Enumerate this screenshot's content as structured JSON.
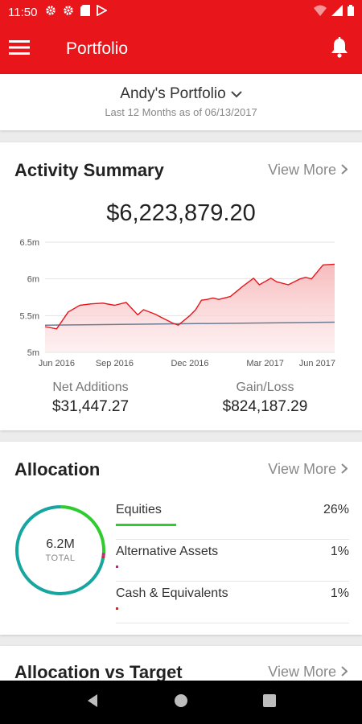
{
  "status_bar": {
    "time": "11:50"
  },
  "app_bar": {
    "title": "Portfolio"
  },
  "portfolio": {
    "name": "Andy's Portfolio",
    "subtitle": "Last 12 Months as of 06/13/2017"
  },
  "activity": {
    "title": "Activity Summary",
    "view_more": "View More",
    "total": "$6,223,879.20",
    "net_additions_label": "Net Additions",
    "net_additions_value": "$31,447.27",
    "gain_loss_label": "Gain/Loss",
    "gain_loss_value": "$824,187.29"
  },
  "chart_data": {
    "type": "area",
    "y_tick_labels": [
      "6.5m",
      "6m",
      "5.5m",
      "5m"
    ],
    "x_tick_labels": [
      "Jun 2016",
      "Sep 2016",
      "Dec 2016",
      "Mar 2017",
      "Jun 2017"
    ],
    "ylim": [
      5000000,
      6500000
    ],
    "series": [
      {
        "color": "#e8151b",
        "x": [
          0,
          4,
          8,
          12,
          16,
          20,
          24,
          28,
          32,
          34,
          38,
          40,
          44,
          46,
          50,
          52,
          54,
          56,
          58,
          60,
          64,
          68,
          72,
          74,
          78,
          80,
          84,
          88,
          90,
          92,
          96,
          100
        ],
        "y": [
          5350000,
          5320000,
          5550000,
          5640000,
          5660000,
          5670000,
          5640000,
          5680000,
          5510000,
          5580000,
          5520000,
          5480000,
          5400000,
          5370000,
          5500000,
          5580000,
          5710000,
          5720000,
          5740000,
          5720000,
          5760000,
          5890000,
          6010000,
          5920000,
          6010000,
          5960000,
          5920000,
          6000000,
          6020000,
          6000000,
          6190000,
          6200000
        ]
      },
      {
        "color": "#6b7c93",
        "x": [
          0,
          100
        ],
        "y": [
          5370000,
          5410000
        ]
      }
    ]
  },
  "allocation": {
    "title": "Allocation",
    "view_more": "View More",
    "total_value": "6.2M",
    "total_label": "TOTAL",
    "items": [
      {
        "name": "Equities",
        "percent": "26%",
        "value": 26,
        "color": "#2ecc2e"
      },
      {
        "name": "Alternative Assets",
        "percent": "1%",
        "value": 1,
        "color": "#b5297f"
      },
      {
        "name": "Cash & Equivalents",
        "percent": "1%",
        "value": 1,
        "color": "#d6281e"
      }
    ],
    "donut_segments": [
      {
        "value": 26,
        "color": "#2ecc2e"
      },
      {
        "value": 1,
        "color": "#b5297f"
      },
      {
        "value": 1,
        "color": "#d6281e"
      },
      {
        "value": 72,
        "color": "#17a5a0"
      }
    ]
  },
  "target": {
    "title": "Allocation vs Target",
    "view_more": "View More"
  }
}
